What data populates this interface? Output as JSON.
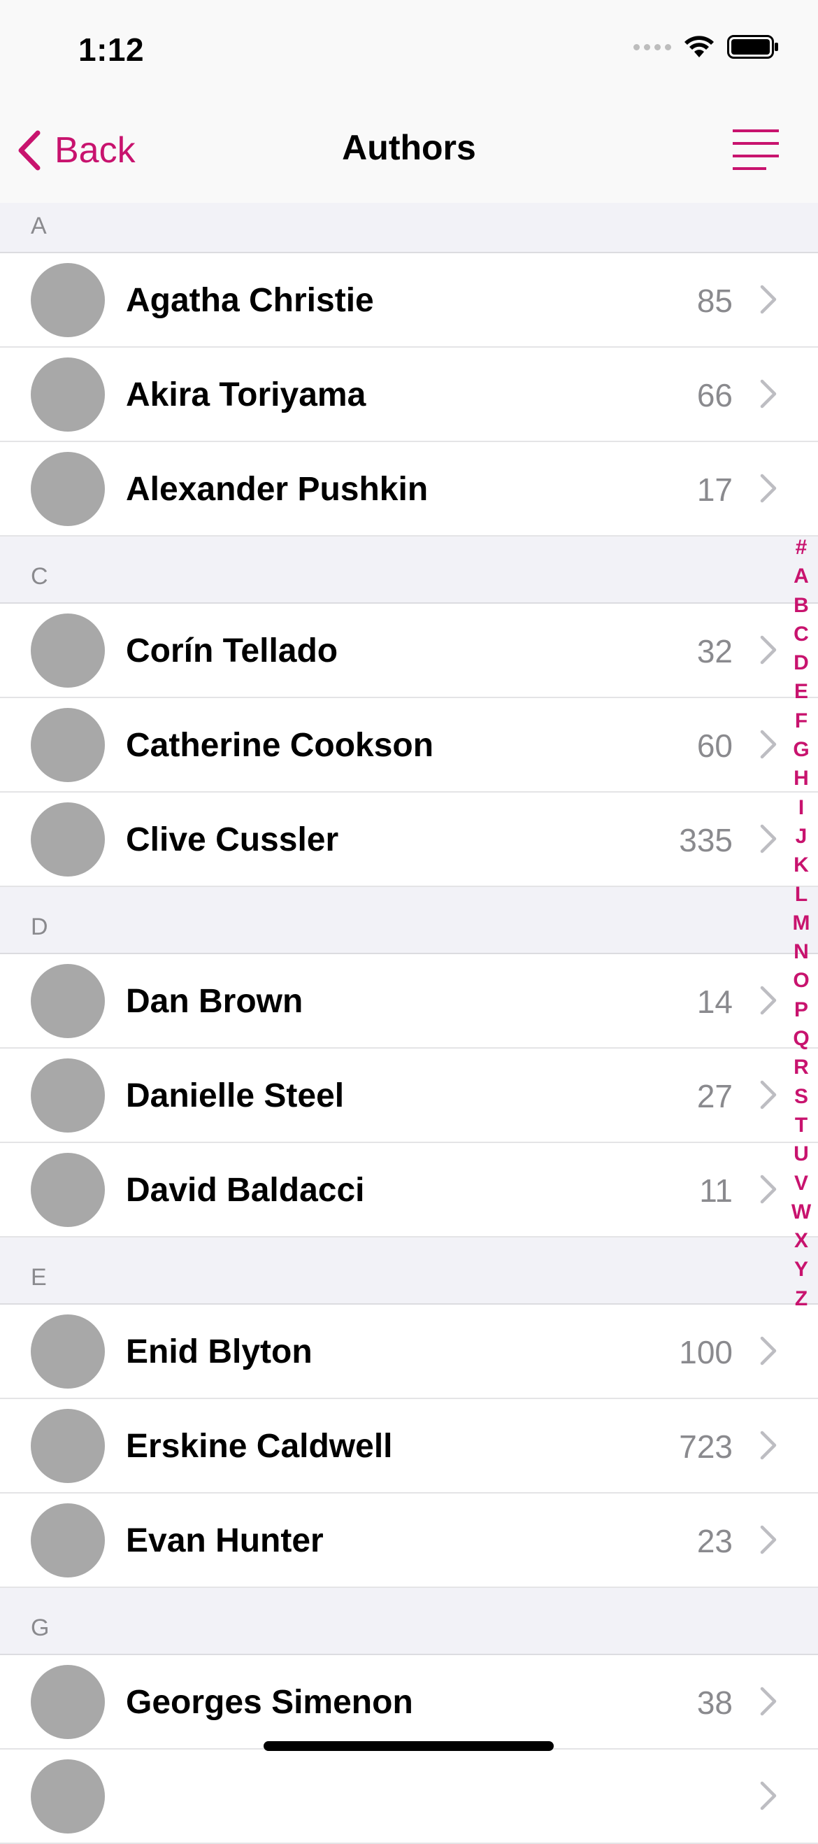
{
  "status_bar": {
    "time": "1:12",
    "icons": [
      "signal-icon",
      "wifi-icon",
      "battery-icon"
    ]
  },
  "nav": {
    "back_label": "Back",
    "title": "Authors",
    "menu_icon": "menu-lines-icon",
    "accent_color": "#C8136E"
  },
  "sections": [
    {
      "letter": "A",
      "authors": [
        {
          "name": "Agatha Christie",
          "count": "85"
        },
        {
          "name": "Akira Toriyama",
          "count": "66"
        },
        {
          "name": "Alexander Pushkin",
          "count": "17"
        }
      ]
    },
    {
      "letter": "C",
      "authors": [
        {
          "name": "Corín Tellado",
          "count": "32"
        },
        {
          "name": "Catherine Cookson",
          "count": "60"
        },
        {
          "name": "Clive Cussler",
          "count": "335"
        }
      ]
    },
    {
      "letter": "D",
      "authors": [
        {
          "name": "Dan Brown",
          "count": "14"
        },
        {
          "name": "Danielle Steel",
          "count": "27"
        },
        {
          "name": "David Baldacci",
          "count": "11"
        }
      ]
    },
    {
      "letter": "E",
      "authors": [
        {
          "name": "Enid Blyton",
          "count": "100"
        },
        {
          "name": "Erskine Caldwell",
          "count": "723"
        },
        {
          "name": "Evan Hunter",
          "count": "23"
        }
      ]
    },
    {
      "letter": "G",
      "authors": [
        {
          "name": "Georges Simenon",
          "count": "38"
        },
        {
          "name": "",
          "count": ""
        }
      ]
    }
  ],
  "index_letters": [
    "#",
    "A",
    "B",
    "C",
    "D",
    "E",
    "F",
    "G",
    "H",
    "I",
    "J",
    "K",
    "L",
    "M",
    "N",
    "O",
    "P",
    "Q",
    "R",
    "S",
    "T",
    "U",
    "V",
    "W",
    "X",
    "Y",
    "Z"
  ]
}
